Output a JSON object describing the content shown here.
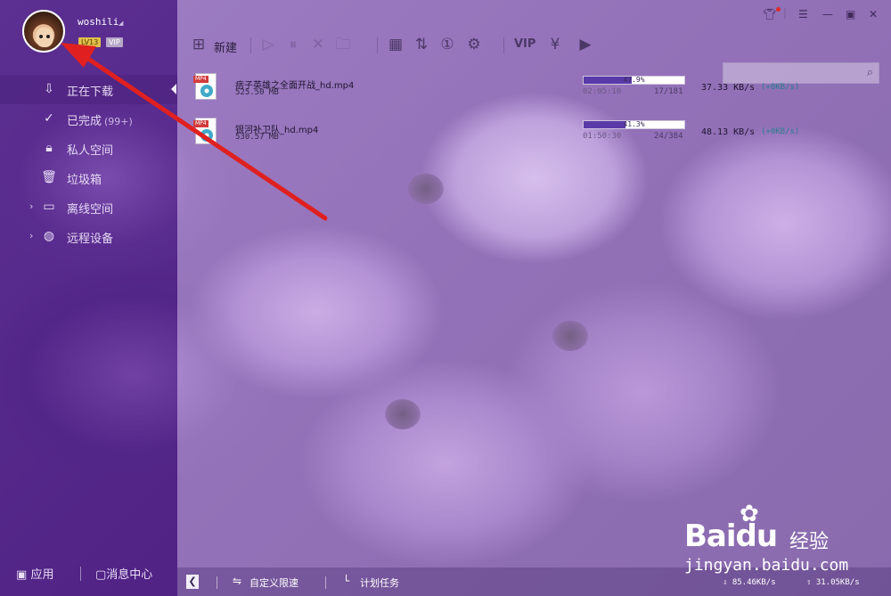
{
  "user": {
    "name": "woshili",
    "level": "LV13",
    "vip": "VIP"
  },
  "sidebar": {
    "items": [
      {
        "label": "正在下载",
        "count": "",
        "icon": "download-arrow-icon"
      },
      {
        "label": "已完成",
        "count": "(99+)",
        "icon": "check-circle-icon"
      },
      {
        "label": "私人空间",
        "count": "",
        "icon": "lock-icon"
      },
      {
        "label": "垃圾箱",
        "count": "",
        "icon": "trash-icon"
      },
      {
        "label": "离线空间",
        "count": "",
        "icon": "cloud-monitor-icon"
      },
      {
        "label": "远程设备",
        "count": "",
        "icon": "remote-device-icon"
      }
    ],
    "apps": "应用",
    "messages": "消息中心"
  },
  "toolbar": {
    "new_label": "新建"
  },
  "tasks": [
    {
      "name": "痞子英雄之全面开战_hd.mp4",
      "size": "525.50 MB",
      "progress": 47.9,
      "progress_text": "47.9%",
      "elapsed": "02:05:10",
      "pieces": "17/181",
      "speed": "37.33 KB/s",
      "bonus": "(+0KB/s)"
    },
    {
      "name": "银河补卫队_hd.mp4",
      "size": "530.57 MB",
      "progress": 41.3,
      "progress_text": "41.3%",
      "elapsed": "01:50:30",
      "pieces": "24/384",
      "speed": "48.13 KB/s",
      "bonus": "(+0KB/s)"
    }
  ],
  "statusbar": {
    "speed_limit": "自定义限速",
    "plan": "计划任务",
    "down_total": "85.46KB/s",
    "up_total": "31.05KB/s"
  },
  "watermark": {
    "brand": "Baidu",
    "cn": "经验",
    "url": "jingyan.baidu.com"
  },
  "colors": {
    "accent": "#5a3aa8",
    "arrow": "#e02020"
  }
}
